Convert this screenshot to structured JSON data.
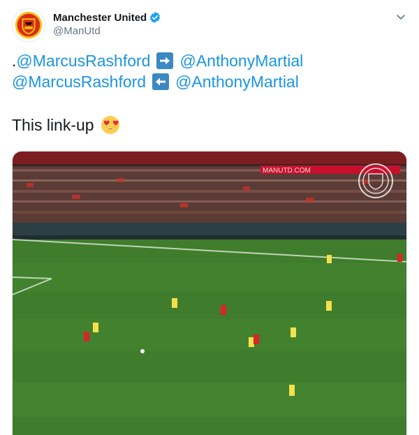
{
  "account": {
    "display_name": "Manchester United",
    "handle": "@ManUtd",
    "verified": true,
    "avatar_icon": "club-crest-icon"
  },
  "menu": {
    "icon": "chevron-down-icon"
  },
  "tweet": {
    "line1": {
      "prefix": ".",
      "mention_a": "@MarcusRashford",
      "arrow": "right-arrow-emoji",
      "mention_b": "@AnthonyMartial"
    },
    "line2": {
      "mention_a": "@MarcusRashford",
      "arrow": "left-arrow-emoji",
      "mention_b": "@AnthonyMartial"
    },
    "line3": {
      "text": "This link-up",
      "emoji": "heart-eyes-emoji"
    }
  },
  "media": {
    "type": "video",
    "stadium_banner": "MANUTD.COM",
    "watermark_icon": "club-crest-watermark"
  },
  "colors": {
    "link": "#1b95e0",
    "verified": "#1da1f2",
    "arrow_box": "#3b88c3",
    "pitch": "#3f7d2c"
  }
}
